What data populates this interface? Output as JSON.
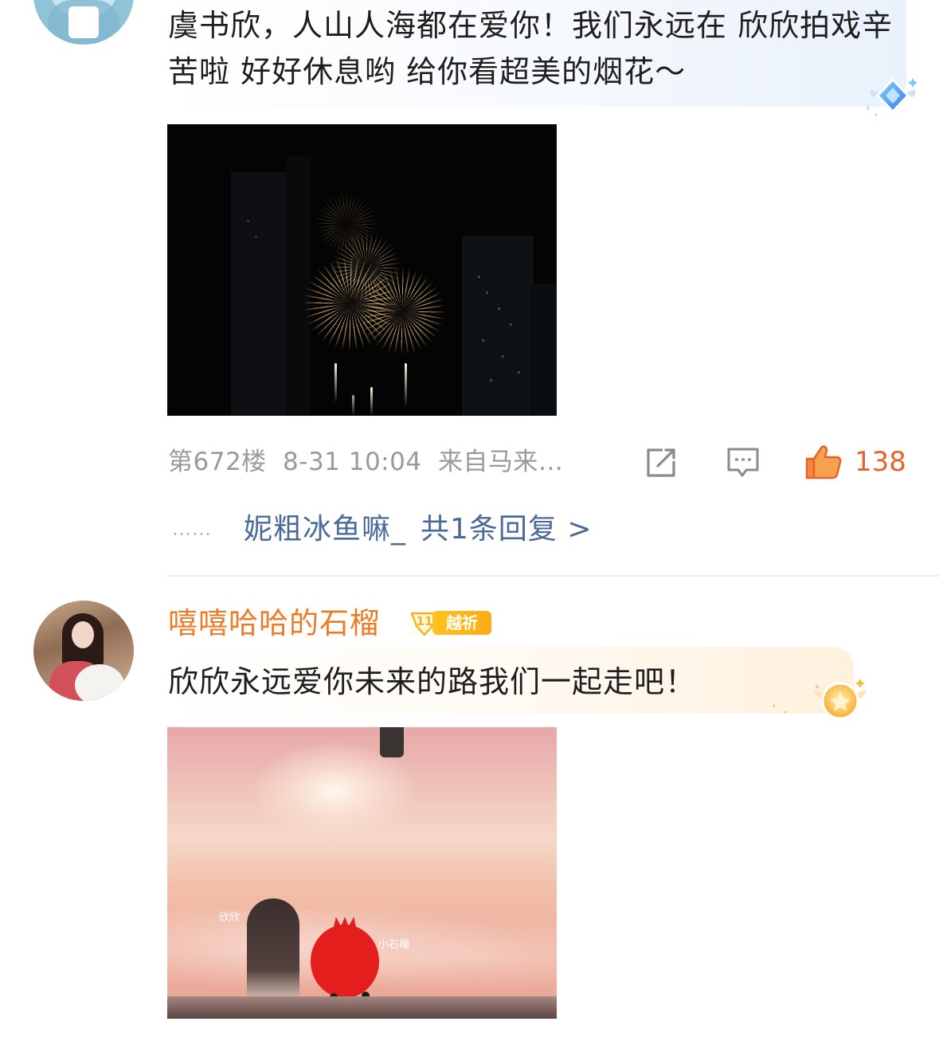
{
  "comments": [
    {
      "text": "虞书欣，人山人海都在爱你！我们永远在 欣欣拍戏辛苦啦 好好休息哟 给你看超美的烟花～",
      "image_alt": "",
      "floor": "第672楼",
      "date": "8-31 10:04",
      "location": "来自马来…",
      "like_count": "138",
      "reply_preview": {
        "dots": "……",
        "user": "妮粗冰鱼嘛_",
        "count_text": "共1条回复 >"
      },
      "bubble_badge_icon": "blue-diamond-badge-icon",
      "bubble_color": "#e9f1fb"
    },
    {
      "username": "嘻嘻哈哈的石榴",
      "fan_level": "11",
      "fan_group": "越祈",
      "text": "欣欣永远爱你未来的路我们一起走吧！",
      "image_labels": {
        "left": "欣欣",
        "right": "小石榴"
      },
      "bubble_badge_icon": "gold-star-badge-icon",
      "bubble_color": "#fff1de"
    }
  ],
  "colors": {
    "username": "#ef7a24",
    "like_active": "#e8632b",
    "reply_link": "#4a6a98",
    "meta_gray": "#9a9a9a",
    "badge_gold": "#ffb81a"
  },
  "icons": {
    "share": "share-icon",
    "comment": "comment-icon",
    "like": "thumbs-up-icon"
  }
}
